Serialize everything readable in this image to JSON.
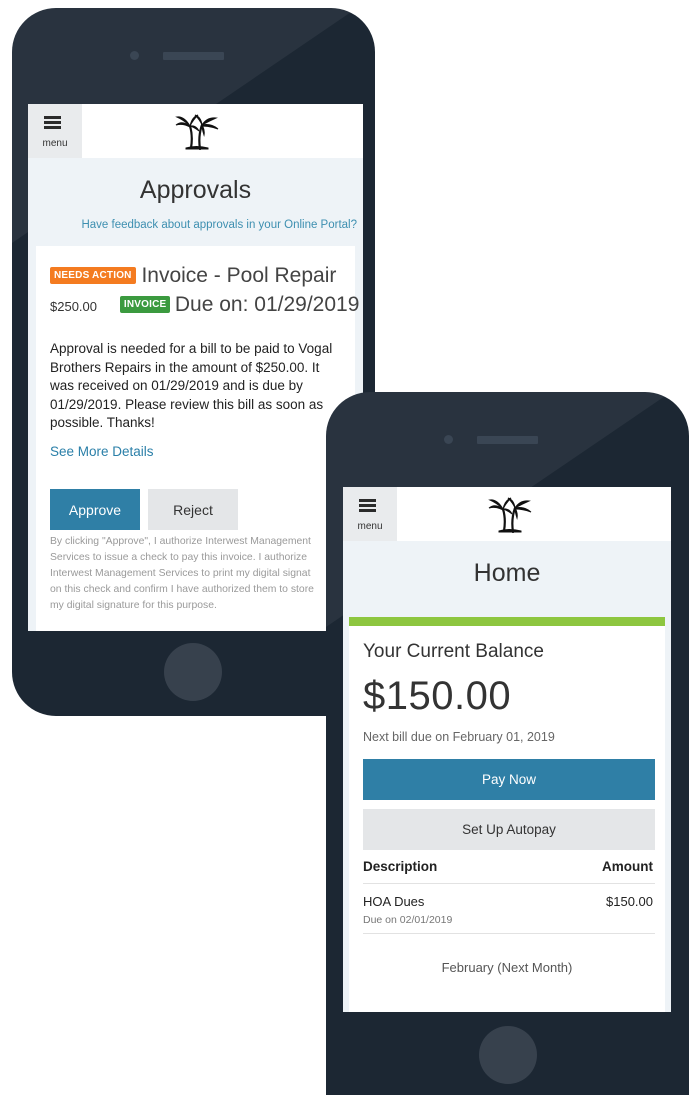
{
  "approvals_phone": {
    "menu_label": "menu",
    "title": "Approvals",
    "feedback_link": "Have feedback about approvals in your Online Portal?",
    "invoice": {
      "badge_status": "NEEDS ACTION",
      "title": "Invoice - Pool Repair",
      "amount": "$250.00",
      "badge_type": "INVOICE",
      "due": "Due on: 01/29/2019",
      "description": "Approval is needed for a bill to be paid to Vogal Brothers Repairs in the amount of $250.00. It was received on 01/29/2019 and is due by 01/29/2019. Please review this bill as soon as possible. Thanks!",
      "see_more": "See More Details",
      "approve_label": "Approve",
      "reject_label": "Reject",
      "disclaimer_lines": [
        "By clicking \"Approve\", I authorize Interwest Management",
        "Services to issue a check to pay this invoice. I authorize",
        "Interwest Management Services to print my digital signat",
        "on this check and confirm I have authorized them to store",
        "my digital signature for this purpose."
      ]
    }
  },
  "home_phone": {
    "menu_label": "menu",
    "title": "Home",
    "balance_label": "Your Current Balance",
    "balance_amount": "$150.00",
    "next_bill": "Next bill due on February 01, 2019",
    "pay_now_label": "Pay Now",
    "autopay_label": "Set Up Autopay",
    "table": {
      "headers": [
        "Description",
        "Amount"
      ],
      "rows": [
        {
          "description": "HOA Dues",
          "subtext": "Due on 02/01/2019",
          "amount": "$150.00"
        }
      ]
    },
    "next_month_label": "February (Next Month)"
  },
  "colors": {
    "phone_body": "#1c2733",
    "primary_button": "#2f7fa6",
    "needs_action_badge": "#f47b20",
    "invoice_badge": "#3b9a3f",
    "balance_accent_bar": "#8dc63f",
    "link": "#2a7fa8"
  },
  "icons": [
    "hamburger-menu-icon",
    "palm-tree-logo"
  ]
}
